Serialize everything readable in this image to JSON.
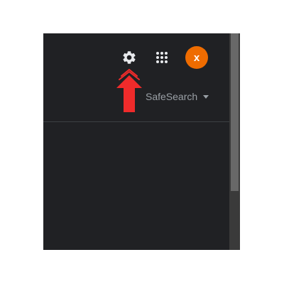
{
  "header": {
    "settings_icon": "gear-icon",
    "apps_icon": "apps-grid-icon",
    "avatar_letter": "x"
  },
  "toolbar": {
    "safesearch_label": "SafeSearch",
    "safesearch_icon": "caret-down-icon"
  },
  "annotation": {
    "icon": "red-up-arrow-icon",
    "color": "#ef2b2b"
  },
  "colors": {
    "background": "#202124",
    "avatar": "#ef6c00",
    "text_muted": "#9aa0a6",
    "icon": "#e8eaed"
  }
}
